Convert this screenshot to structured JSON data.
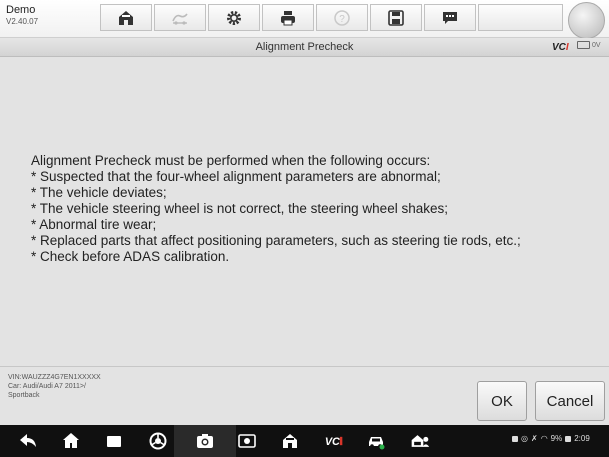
{
  "brand": {
    "title": "Demo",
    "version": "V2.40.07"
  },
  "toolbar": {
    "buttons": [
      {
        "icon": "home-icon"
      },
      {
        "icon": "vehicle-swap-icon"
      },
      {
        "icon": "settings-icon"
      },
      {
        "icon": "print-icon"
      },
      {
        "icon": "help-icon"
      },
      {
        "icon": "save-icon"
      },
      {
        "icon": "data-logging-icon"
      }
    ]
  },
  "titlebar": {
    "title": "Alignment Precheck",
    "vci_logo_main": "VC",
    "vci_logo_accent": "I",
    "voltage": "0V"
  },
  "message": {
    "lines": [
      "Alignment Precheck must be performed  when the following occurs:",
      "* Suspected that the four-wheel alignment parameters are abnormal;",
      "* The vehicle deviates;",
      "* The vehicle steering wheel is not correct, the steering wheel shakes;",
      "* Abnormal tire wear;",
      "* Replaced parts that affect positioning parameters, such as steering tie rods, etc.;",
      "* Check before ADAS calibration."
    ]
  },
  "vehicle_info": {
    "vin": "VIN:WAUZZZ4G7EN1XXXXX",
    "car": "Car: Audi/Audi A7 2011>/",
    "body": "Sportback"
  },
  "buttons": {
    "ok": "OK",
    "cancel": "Cancel"
  },
  "navbar": {
    "icons": [
      "back-icon",
      "home-icon",
      "recents-icon",
      "browser-icon",
      "camera-icon",
      "screen-record-icon",
      "maxisys-home-icon",
      "vci-icon",
      "car-icon",
      "garage-icon"
    ],
    "clock": "2:09",
    "battery": "9%"
  },
  "colors": {
    "accent_red": "#d9352a",
    "background": "#e3e3e3",
    "navbar": "#101010"
  }
}
